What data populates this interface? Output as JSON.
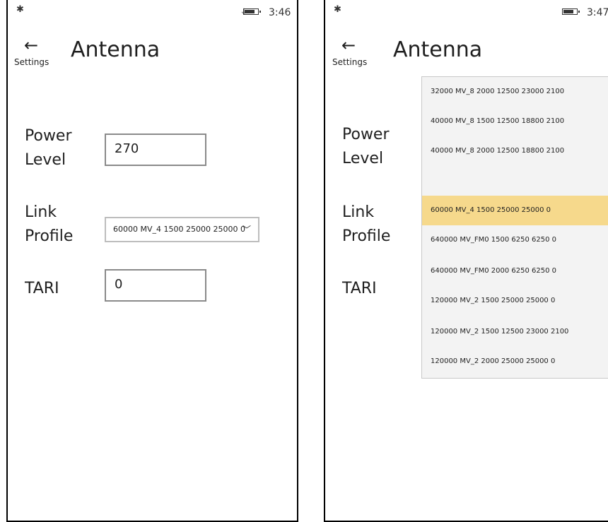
{
  "left": {
    "status": {
      "time": "3:46"
    },
    "header": {
      "back_label": "Settings",
      "title": "Antenna"
    },
    "power": {
      "label_line1": "Power",
      "label_line2": "Level",
      "value": "270"
    },
    "link_profile": {
      "label_line1": "Link",
      "label_line2": "Profile",
      "selected": "60000 MV_4 1500 25000 25000 0"
    },
    "tari": {
      "label": "TARI",
      "value": "0"
    }
  },
  "right": {
    "status": {
      "time": "3:47"
    },
    "header": {
      "back_label": "Settings",
      "title": "Antenna"
    },
    "power": {
      "label_line1": "Power",
      "label_line2": "Level"
    },
    "link_profile": {
      "label_line1": "Link",
      "label_line2": "Profile"
    },
    "tari": {
      "label": "TARI"
    },
    "dropdown": {
      "options": [
        "32000 MV_8 2000 12500 23000 2100",
        "40000 MV_8 1500 12500 18800 2100",
        "40000 MV_8 2000 12500 18800 2100",
        "",
        "60000 MV_4 1500 25000 25000 0",
        "640000 MV_FM0 1500 6250 6250 0",
        "640000 MV_FM0 2000 6250 6250 0",
        "120000 MV_2 1500 25000 25000 0",
        "120000 MV_2 1500 12500 23000 2100",
        "120000 MV_2 2000 25000 25000 0"
      ],
      "selected_index": 4
    }
  },
  "colors": {
    "selected_highlight": "#f6d98c",
    "text": "#1f1f1f"
  }
}
